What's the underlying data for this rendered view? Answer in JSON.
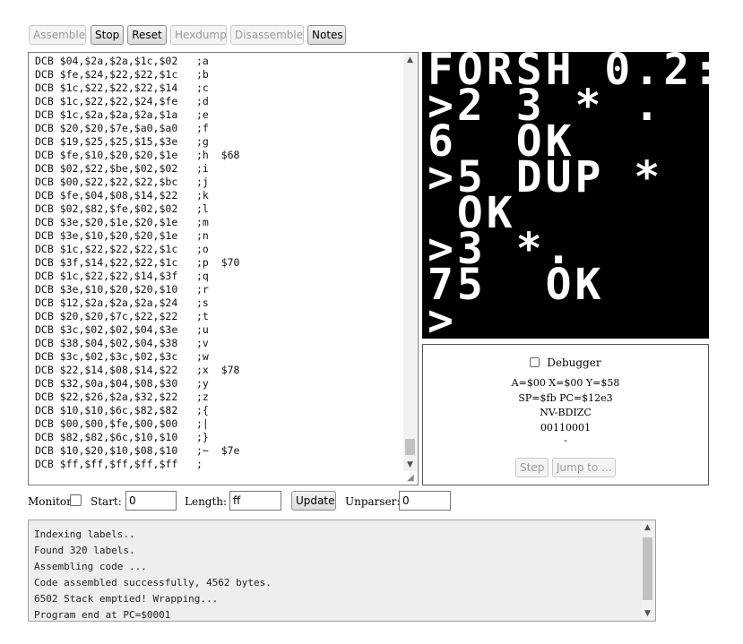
{
  "toolbar": {
    "assemble": "Assemble",
    "stop": "Stop",
    "reset": "Reset",
    "hexdump": "Hexdump",
    "disassemble": "Disassemble",
    "notes": "Notes"
  },
  "editor": {
    "lines": [
      "DCB $04,$2a,$2a,$1c,$02   ;a",
      "DCB $fe,$24,$22,$22,$1c   ;b",
      "DCB $1c,$22,$22,$22,$14   ;c",
      "DCB $1c,$22,$22,$24,$fe   ;d",
      "DCB $1c,$2a,$2a,$2a,$1a   ;e",
      "DCB $20,$20,$7e,$a0,$a0   ;f",
      "DCB $19,$25,$25,$15,$3e   ;g",
      "DCB $fe,$10,$20,$20,$1e   ;h  $68",
      "DCB $02,$22,$be,$02,$02   ;i",
      "DCB $00,$22,$22,$22,$bc   ;j",
      "DCB $fe,$04,$08,$14,$22   ;k",
      "DCB $02,$82,$fe,$02,$02   ;l",
      "DCB $3e,$20,$1e,$20,$1e   ;m",
      "DCB $3e,$10,$20,$20,$1e   ;n",
      "DCB $1c,$22,$22,$22,$1c   ;o",
      "DCB $3f,$14,$22,$22,$1c   ;p  $70",
      "DCB $1c,$22,$22,$14,$3f   ;q",
      "DCB $3e,$10,$20,$20,$10   ;r",
      "DCB $12,$2a,$2a,$2a,$24   ;s",
      "DCB $20,$20,$7c,$22,$22   ;t",
      "DCB $3c,$02,$02,$04,$3e   ;u",
      "DCB $38,$04,$02,$04,$38   ;v",
      "DCB $3c,$02,$3c,$02,$3c   ;w",
      "DCB $22,$14,$08,$14,$22   ;x  $78",
      "DCB $32,$0a,$04,$08,$30   ;y",
      "DCB $22,$26,$2a,$32,$22   ;z",
      "DCB $10,$10,$6c,$82,$82   ;{",
      "DCB $00,$00,$fe,$00,$00   ;|",
      "DCB $82,$82,$6c,$10,$10   ;}",
      "DCB $10,$20,$10,$08,$10   ;~  $7e",
      "DCB $ff,$ff,$ff,$ff,$ff   ;"
    ]
  },
  "screen": {
    "lines": [
      "FORSH 0.2:",
      ">2 3 * .",
      "6  OK",
      ">5 DUP *",
      " OK",
      ">3 *.",
      "75  OK",
      ">_"
    ]
  },
  "debugger": {
    "label": "Debugger",
    "registers": "A=$00 X=$00 Y=$58",
    "sp_pc": "SP=$fb PC=$12e3",
    "flags_label": "NV-BDIZC",
    "flags_bits": "00110001",
    "dash": "-",
    "step": "Step",
    "jump": "Jump to ..."
  },
  "monitor": {
    "label": "Monitor",
    "start_label": "Start: $",
    "start_value": "0",
    "length_label": "Length: $",
    "length_value": "ff",
    "update": "Update",
    "unparser_label": "Unparser: $",
    "unparser_value": "0"
  },
  "console": {
    "lines": [
      "Indexing labels..",
      "Found 320 labels.",
      "Assembling code ...",
      "Code assembled successfully, 4562 bytes.",
      "6502 Stack emptied! Wrapping...",
      "Program end at PC=$0001"
    ]
  },
  "colors": {
    "screen_bg": "#000000",
    "screen_fg": "#ffffff",
    "console_bg": "#eeeeee"
  }
}
